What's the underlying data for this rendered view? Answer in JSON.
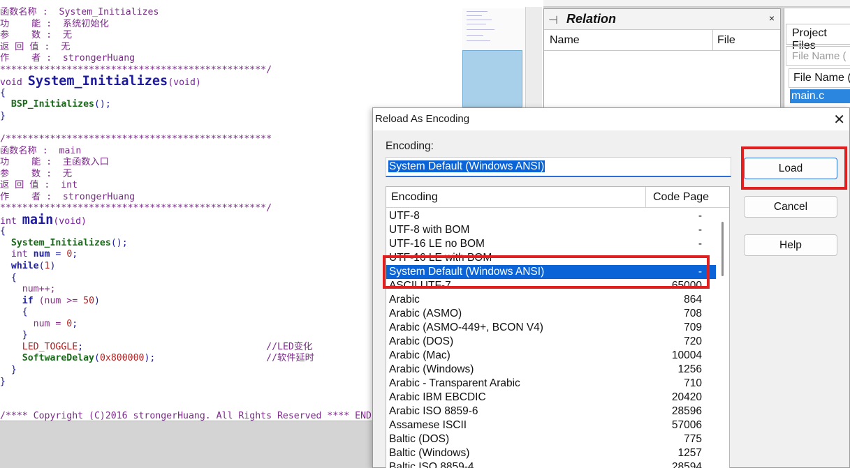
{
  "code_lines": [
    [
      {
        "t": "函数名称 :  System_Initializes",
        "c": "cmt"
      }
    ],
    [
      {
        "t": "功    能 :  系统初始化",
        "c": "cmt"
      }
    ],
    [
      {
        "t": "参    数 :  无",
        "c": "cmt"
      }
    ],
    [
      {
        "t": "返 回 值 :  无",
        "c": "cmt"
      }
    ],
    [
      {
        "t": "作    者 :  strongerHuang",
        "c": "cmt"
      }
    ],
    [
      {
        "t": "************************************************/",
        "c": "cmt"
      }
    ],
    [
      {
        "t": "void ",
        "c": "kw"
      },
      {
        "t": "System_Initializes",
        "c": "big"
      },
      {
        "t": "(void)",
        "c": "kw"
      }
    ],
    [
      {
        "t": "{",
        "c": "pun"
      }
    ],
    [
      {
        "t": "  ",
        "c": "plain"
      },
      {
        "t": "BSP_Initializes",
        "c": "fn"
      },
      {
        "t": "();",
        "c": "pun"
      }
    ],
    [
      {
        "t": "}",
        "c": "pun"
      }
    ],
    [
      {
        "t": "",
        "c": "plain"
      }
    ],
    [
      {
        "t": "/************************************************",
        "c": "cmt"
      }
    ],
    [
      {
        "t": "函数名称 :  main",
        "c": "cmt"
      }
    ],
    [
      {
        "t": "功    能 :  主函数入口",
        "c": "cmt"
      }
    ],
    [
      {
        "t": "参    数 :  无",
        "c": "cmt"
      }
    ],
    [
      {
        "t": "返 回 值 :  int",
        "c": "cmt"
      }
    ],
    [
      {
        "t": "作    者 :  strongerHuang",
        "c": "cmt"
      }
    ],
    [
      {
        "t": "************************************************/",
        "c": "cmt"
      }
    ],
    [
      {
        "t": "int ",
        "c": "kw"
      },
      {
        "t": "main",
        "c": "big"
      },
      {
        "t": "(void)",
        "c": "kw"
      }
    ],
    [
      {
        "t": "{",
        "c": "pun"
      }
    ],
    [
      {
        "t": "  ",
        "c": "plain"
      },
      {
        "t": "System_Initializes",
        "c": "fn"
      },
      {
        "t": "();",
        "c": "pun"
      }
    ],
    [
      {
        "t": "  ",
        "c": "plain"
      },
      {
        "t": "int ",
        "c": "kw"
      },
      {
        "t": "num",
        "c": "kwb"
      },
      {
        "t": " = ",
        "c": "pun"
      },
      {
        "t": "0",
        "c": "num"
      },
      {
        "t": ";",
        "c": "pun"
      }
    ],
    [
      {
        "t": "  ",
        "c": "plain"
      },
      {
        "t": "while",
        "c": "kwb"
      },
      {
        "t": "(",
        "c": "pun"
      },
      {
        "t": "1",
        "c": "num"
      },
      {
        "t": ")",
        "c": "pun"
      }
    ],
    [
      {
        "t": "  {",
        "c": "pun"
      }
    ],
    [
      {
        "t": "    ",
        "c": "plain"
      },
      {
        "t": "num++;",
        "c": "id"
      }
    ],
    [
      {
        "t": "    ",
        "c": "plain"
      },
      {
        "t": "if",
        "c": "kwb"
      },
      {
        "t": " (num >= ",
        "c": "id"
      },
      {
        "t": "50",
        "c": "num"
      },
      {
        "t": ")",
        "c": "pun"
      }
    ],
    [
      {
        "t": "    {",
        "c": "pun"
      }
    ],
    [
      {
        "t": "      ",
        "c": "plain"
      },
      {
        "t": "num = ",
        "c": "id"
      },
      {
        "t": "0",
        "c": "num"
      },
      {
        "t": ";",
        "c": "pun"
      }
    ],
    [
      {
        "t": "    }",
        "c": "pun"
      }
    ],
    [
      {
        "t": "    ",
        "c": "plain"
      },
      {
        "t": "LED_TOGGLE",
        "c": "mac"
      },
      {
        "t": ";                                 ",
        "c": "pun"
      },
      {
        "t": "//LED变化",
        "c": "cmt"
      }
    ],
    [
      {
        "t": "    ",
        "c": "plain"
      },
      {
        "t": "SoftwareDelay",
        "c": "fn"
      },
      {
        "t": "(",
        "c": "pun"
      },
      {
        "t": "0x800000",
        "c": "num"
      },
      {
        "t": ");                    ",
        "c": "pun"
      },
      {
        "t": "//软件延时",
        "c": "cmt"
      }
    ],
    [
      {
        "t": "  }",
        "c": "pun"
      }
    ],
    [
      {
        "t": "}",
        "c": "pun"
      }
    ],
    [
      {
        "t": "",
        "c": "plain"
      }
    ],
    [
      {
        "t": "",
        "c": "plain"
      }
    ],
    [
      {
        "t": "/**** Copyright (C)2016 strongerHuang. All Rights Reserved **** END",
        "c": "cmt"
      }
    ]
  ],
  "relation": {
    "title": "Relation",
    "close": "×",
    "col_name": "Name",
    "col_file": "File"
  },
  "project": {
    "tab": "Project Files",
    "search_placeholder": "File Name (",
    "col_header": "File Name (",
    "selected_file": "main.c"
  },
  "dialog": {
    "title": "Reload As Encoding",
    "close": "✕",
    "encoding_label": "Encoding:",
    "encoding_value": "System Default (Windows ANSI)",
    "col_encoding": "Encoding",
    "col_codepage": "Code Page",
    "rows": [
      {
        "name": "UTF-8",
        "code": "-"
      },
      {
        "name": "UTF-8 with BOM",
        "code": "-"
      },
      {
        "name": "UTF-16 LE no BOM",
        "code": "-"
      },
      {
        "name": "UTF-16 LE with BOM",
        "code": ""
      },
      {
        "name": "System Default (Windows ANSI)",
        "code": "-",
        "selected": true
      },
      {
        "name": "ASCII UTF-7",
        "code": "65000"
      },
      {
        "name": "Arabic",
        "code": "864"
      },
      {
        "name": "Arabic (ASMO)",
        "code": "708"
      },
      {
        "name": "Arabic (ASMO-449+, BCON V4)",
        "code": "709"
      },
      {
        "name": "Arabic (DOS)",
        "code": "720"
      },
      {
        "name": "Arabic (Mac)",
        "code": "10004"
      },
      {
        "name": "Arabic (Windows)",
        "code": "1256"
      },
      {
        "name": "Arabic - Transparent Arabic",
        "code": "710"
      },
      {
        "name": "Arabic IBM EBCDIC",
        "code": "20420"
      },
      {
        "name": "Arabic ISO 8859-6",
        "code": "28596"
      },
      {
        "name": "Assamese ISCII",
        "code": "57006"
      },
      {
        "name": "Baltic (DOS)",
        "code": "775"
      },
      {
        "name": "Baltic (Windows)",
        "code": "1257"
      },
      {
        "name": "Baltic ISO 8859-4",
        "code": "28594"
      }
    ],
    "buttons": {
      "load": "Load",
      "cancel": "Cancel",
      "help": "Help"
    }
  },
  "colors": {
    "accent": "#0a64d8",
    "highlight_box": "#e02020"
  }
}
